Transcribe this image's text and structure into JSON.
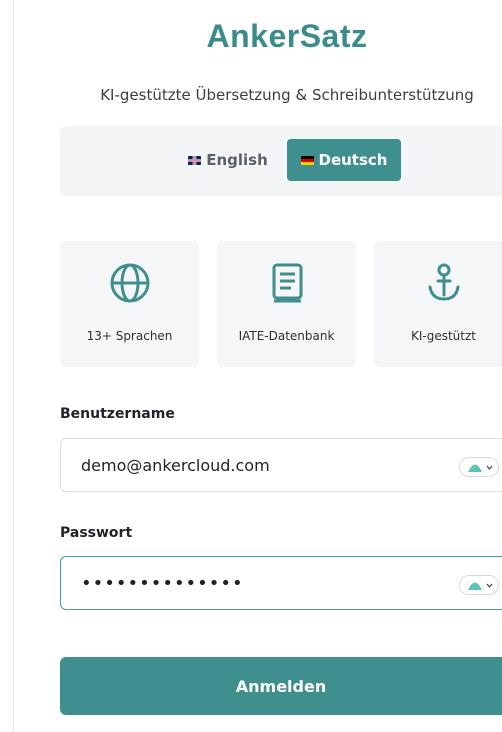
{
  "app": {
    "title": "AnkerSatz",
    "subtitle": "KI-gestützte Übersetzung & Schreibunterstützung"
  },
  "language_switch": {
    "english_label": "English",
    "deutsch_label": "Deutsch",
    "selected": "Deutsch"
  },
  "features": [
    {
      "label": "13+ Sprachen",
      "icon": "globe-icon"
    },
    {
      "label": "IATE-Datenbank",
      "icon": "book-icon"
    },
    {
      "label": "KI-gestützt",
      "icon": "anchor-icon"
    }
  ],
  "form": {
    "username_label": "Benutzername",
    "username_value": "demo@ankercloud.com",
    "password_label": "Passwort",
    "password_value": "••••••••••••••",
    "submit_label": "Anmelden"
  },
  "colors": {
    "accent": "#3f8f8f",
    "title": "#3a8c8c",
    "card_bg": "#f5f6f7"
  }
}
